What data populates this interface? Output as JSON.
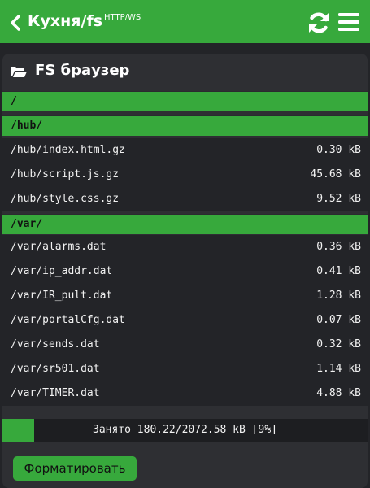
{
  "header": {
    "title": "Кухня/fs",
    "title_sup": "HTTP/WS",
    "accent_color": "#37a93c",
    "icons": [
      "chevron-left-icon",
      "refresh-icon",
      "menu-icon"
    ]
  },
  "panel": {
    "title": "FS браузер",
    "icon": "folder-open-icon"
  },
  "root_dir": "/",
  "dirs": [
    {
      "name": "/hub/",
      "files": [
        {
          "name": "/hub/index.html.gz",
          "size": "0.30 kB"
        },
        {
          "name": "/hub/script.js.gz",
          "size": "45.68 kB"
        },
        {
          "name": "/hub/style.css.gz",
          "size": "9.52 kB"
        }
      ]
    },
    {
      "name": "/var/",
      "files": [
        {
          "name": "/var/alarms.dat",
          "size": "0.36 kB"
        },
        {
          "name": "/var/ip_addr.dat",
          "size": "0.41 kB"
        },
        {
          "name": "/var/IR_pult.dat",
          "size": "1.28 kB"
        },
        {
          "name": "/var/portalCfg.dat",
          "size": "0.07 kB"
        },
        {
          "name": "/var/sends.dat",
          "size": "0.32 kB"
        },
        {
          "name": "/var/sr501.dat",
          "size": "1.14 kB"
        },
        {
          "name": "/var/TIMER.dat",
          "size": "4.88 kB"
        }
      ]
    }
  ],
  "usage": {
    "text": "Занято 180.22/2072.58 kB [9%]",
    "fraction": 0.087
  },
  "format_button": "Форматировать"
}
